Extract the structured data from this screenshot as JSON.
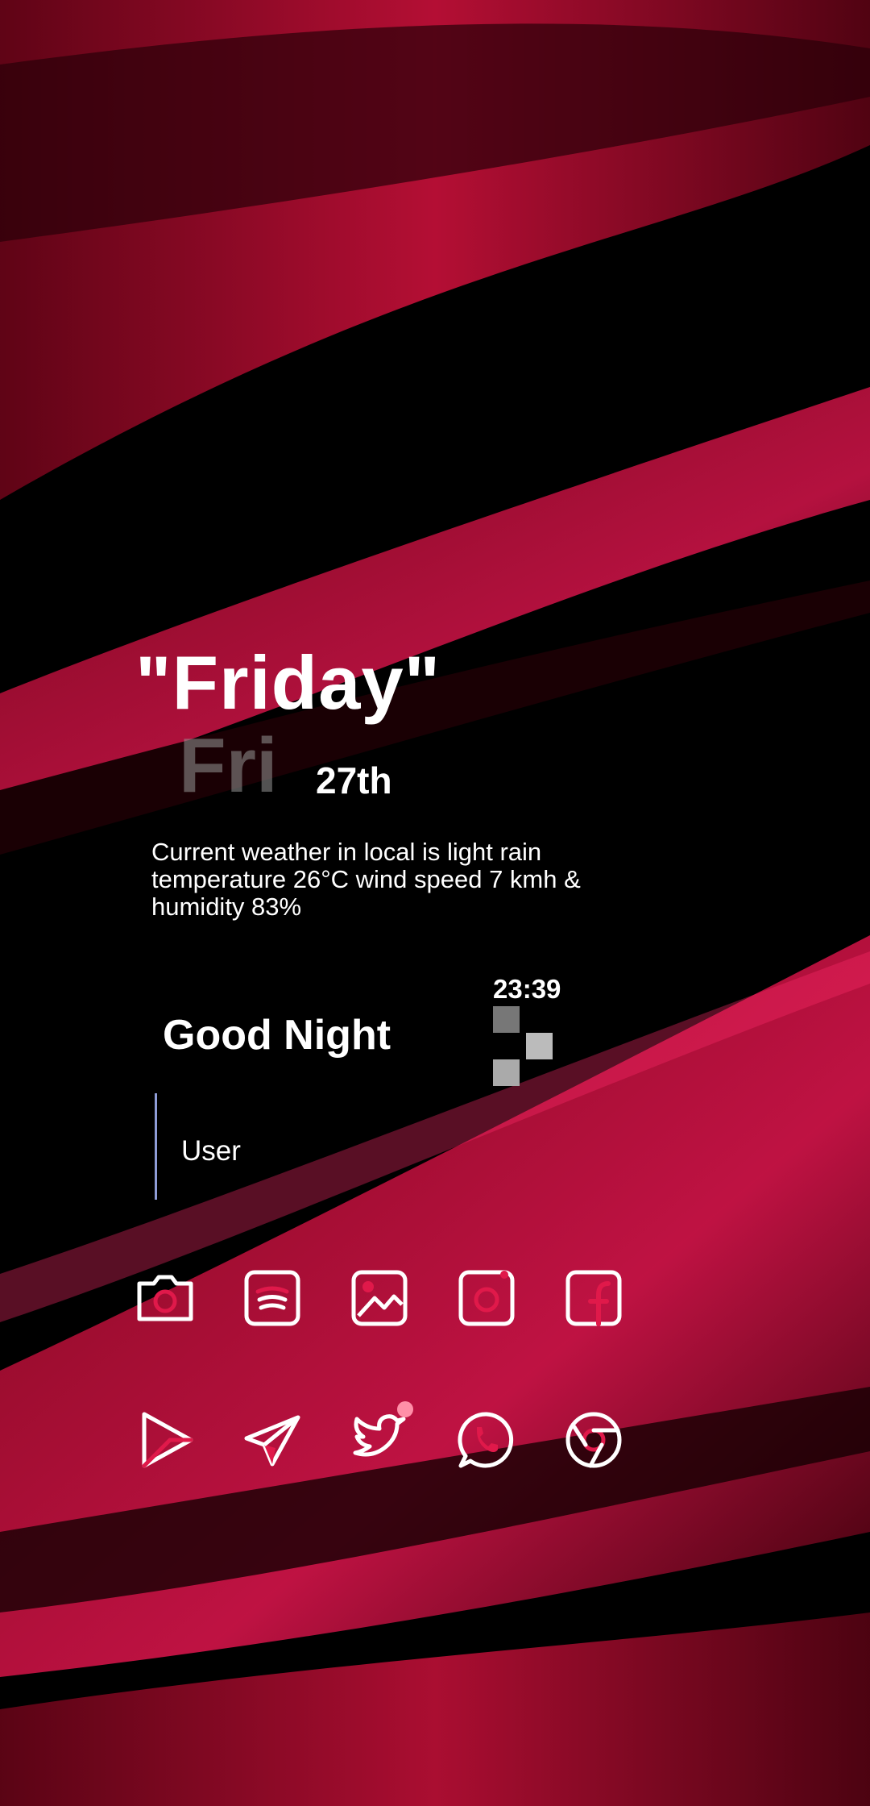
{
  "widgets": {
    "day_title": "\"Friday\"",
    "day_short": "Fri",
    "date": "27th",
    "weather_text": "Current weather in local is light rain temperature 26°C wind speed 7 kmh & humidity 83%",
    "clock": "23:39",
    "greeting": "Good Night",
    "user": "User"
  },
  "apps": {
    "row1": [
      {
        "name": "camera-icon"
      },
      {
        "name": "spotify-icon"
      },
      {
        "name": "gallery-icon"
      },
      {
        "name": "instagram-icon"
      },
      {
        "name": "facebook-icon"
      }
    ],
    "row2": [
      {
        "name": "play-store-icon"
      },
      {
        "name": "telegram-icon"
      },
      {
        "name": "twitter-icon"
      },
      {
        "name": "whatsapp-icon"
      },
      {
        "name": "chrome-icon"
      }
    ]
  },
  "colors": {
    "accent": "#e0194a",
    "wallpaper_dark": "#000000",
    "wallpaper_red": "#b00a2c",
    "user_bar": "#8e9cd6"
  }
}
